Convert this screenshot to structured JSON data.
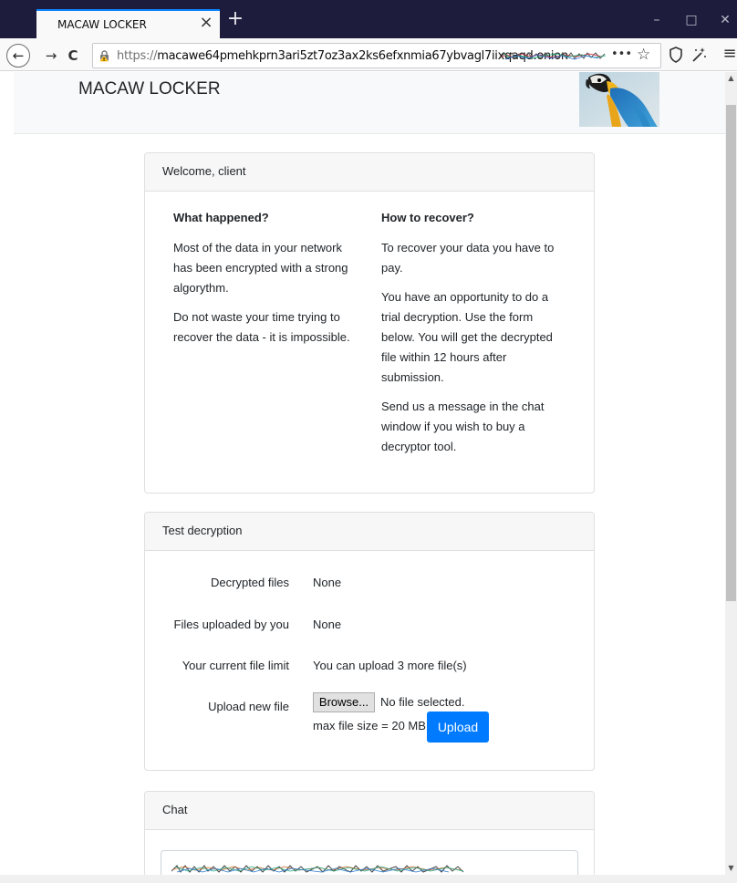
{
  "browser": {
    "tab_title": "MACAW LOCKER",
    "tab_close": "×",
    "new_tab": "+",
    "window_controls": {
      "minimize": "–",
      "maximize": "□",
      "close": "✕"
    },
    "nav": {
      "back": "←",
      "forward": "→",
      "reload": "C"
    },
    "url_protocol": "https://",
    "url_host": "macawe64pmehkprn3ari5zt7oz3ax2ks6efxnmia67ybvagl7iixqaqd.onion",
    "url_more": "•••",
    "url_star": "☆",
    "toolbar_icons": {
      "shield": "⬡",
      "extension": "✨",
      "menu": "≡"
    }
  },
  "page": {
    "site_title": "MACAW LOCKER",
    "welcome_card": {
      "header": "Welcome, client",
      "left": {
        "heading": "What happened?",
        "p1": "Most of the data in your network has been encrypted with a strong algorythm.",
        "p2": "Do not waste your time trying to recover the data - it is impossible."
      },
      "right": {
        "heading": "How to recover?",
        "p1": "To recover your data you have to pay.",
        "p2": "You have an opportunity to do a trial decryption. Use the form below. You will get the decrypted file within 12 hours after submission.",
        "p3": "Send us a message in the chat window if you wish to buy a decryptor tool."
      }
    },
    "test_card": {
      "header": "Test decryption",
      "rows": [
        {
          "label": "Decrypted files",
          "value": "None"
        },
        {
          "label": "Files uploaded by you",
          "value": "None"
        },
        {
          "label": "Your current file limit",
          "value": "You can upload 3 more file(s)"
        }
      ],
      "upload_label": "Upload new file",
      "browse_label": "Browse...",
      "no_file": "No file selected.",
      "max_size": "max file size = 20 MB",
      "upload_button": "Upload"
    },
    "chat_card": {
      "header": "Chat"
    }
  },
  "colors": {
    "titlebar": "#1d1c3c",
    "tab_accent": "#0a84ff",
    "upload_button": "#007bff"
  }
}
